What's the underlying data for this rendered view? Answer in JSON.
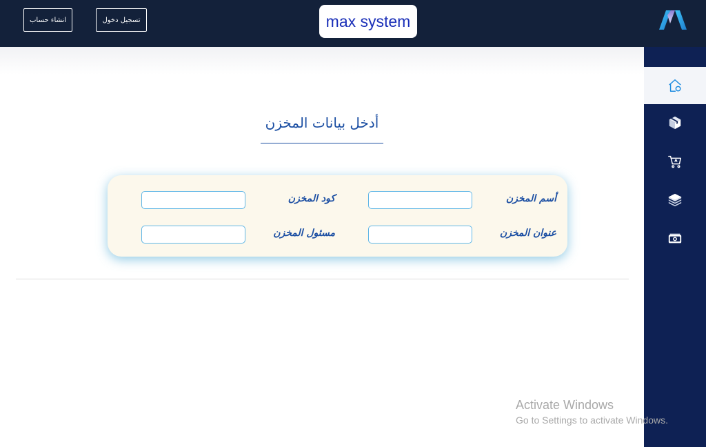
{
  "header": {
    "brand": "max system",
    "login_label": "تسجيل دخول",
    "signup_label": "انشاء حساب"
  },
  "sidebar": {
    "items": [
      {
        "icon": "home-icon",
        "active": true
      },
      {
        "icon": "box-icon",
        "active": false
      },
      {
        "icon": "cart-icon",
        "active": false
      },
      {
        "icon": "layers-icon",
        "active": false
      },
      {
        "icon": "cash-icon",
        "active": false
      }
    ]
  },
  "form": {
    "title": "أدخل بيانات المخزن",
    "fields": {
      "name_label": "أسم المخزن",
      "code_label": "كود المخزن",
      "address_label": "عنوان المخزن",
      "manager_label": "مسئول المخزن",
      "name_value": "",
      "code_value": "",
      "address_value": "",
      "manager_value": ""
    }
  },
  "watermark": {
    "line1": "Activate Windows",
    "line2": "Go to Settings to activate Windows."
  },
  "colors": {
    "header_bg": "#13213a",
    "sidebar_bg": "#0e2154",
    "accent": "#1c4fa3",
    "card_bg": "#fcf8ec",
    "input_border": "#5fb6e6"
  }
}
